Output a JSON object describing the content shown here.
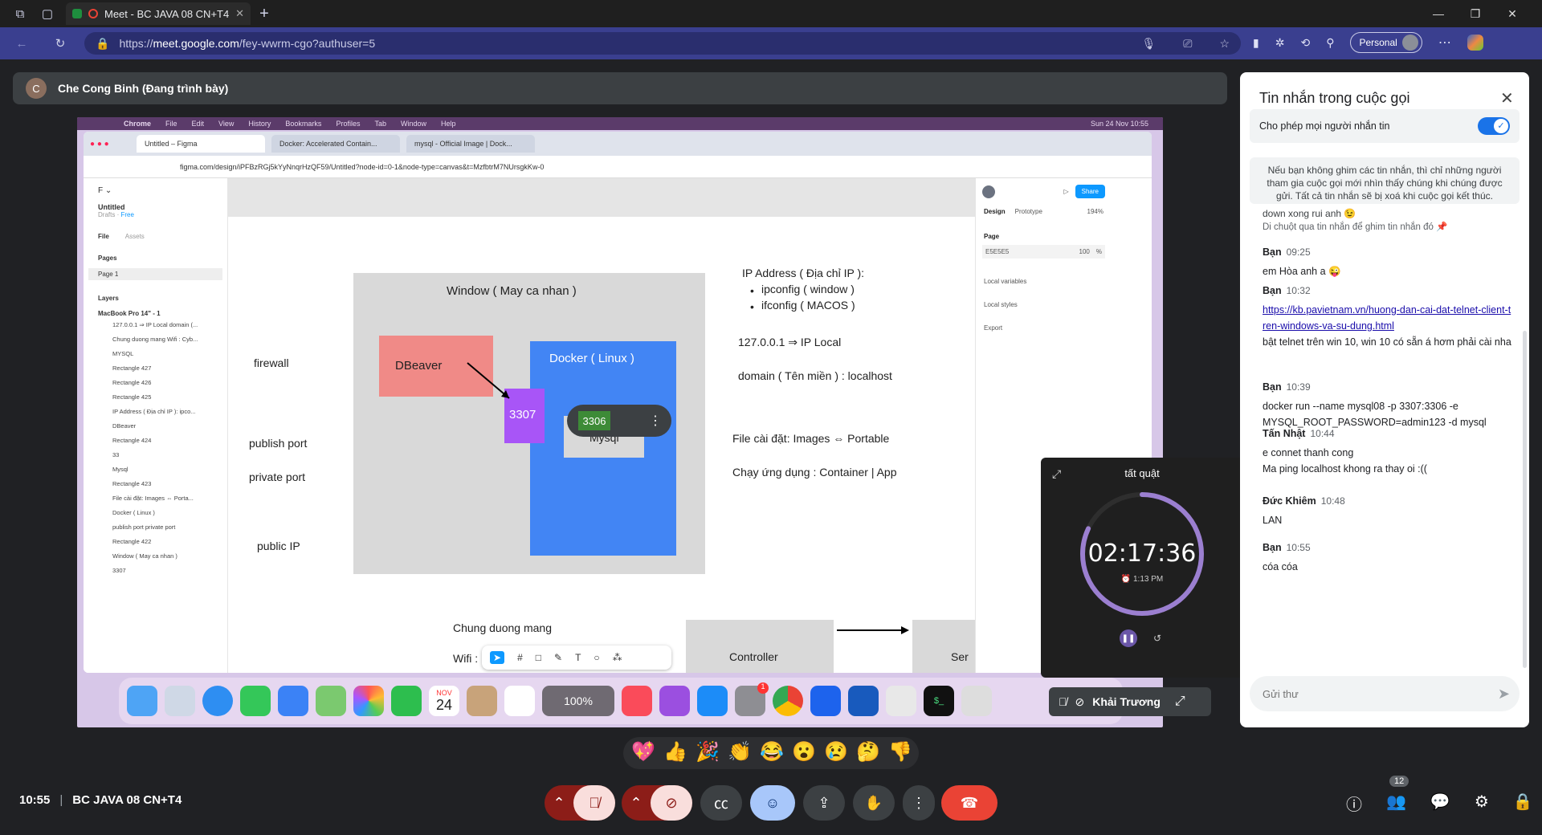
{
  "browser": {
    "tab_title": "Meet - BC JAVA 08 CN+T4",
    "url_prefix": "https://",
    "url_host": "meet.google.com",
    "url_path": "/fey-wwrm-cgo?authuser=5",
    "profile_label": "Personal"
  },
  "presenter": {
    "initial": "C",
    "label": "Che Cong Binh (Đang trình bày)"
  },
  "shared_screen": {
    "mac_menu": [
      "Chrome",
      "File",
      "Edit",
      "View",
      "History",
      "Bookmarks",
      "Profiles",
      "Tab",
      "Window",
      "Help"
    ],
    "mac_clock": "Sun 24 Nov  10:55",
    "tabs": [
      "Untitled – Figma",
      "Docker: Accelerated Contain...",
      "mysql - Official Image | Dock..."
    ],
    "url": "figma.com/design/iPFBzRGj5kYyNnqrHzQF59/Untitled?node-id=0-1&node-type=canvas&t=MzfbtrM7NUrsgkKw-0",
    "file_name": "Untitled",
    "drafts": "Drafts",
    "free": "Free",
    "file_tab": "File",
    "assets_tab": "Assets",
    "pages_label": "Pages",
    "page1": "Page 1",
    "layers_label": "Layers",
    "frame_name": "MacBook Pro 14\" - 1",
    "layers": [
      "127.0.0.1 ⇒ IP Local domain (...",
      "Chung duong mang Wifi : Cyb...",
      "MYSQL",
      "Rectangle 427",
      "Rectangle 426",
      "Rectangle 425",
      "IP Address ( Địa chỉ IP ): ipco...",
      "DBeaver",
      "Rectangle 424",
      "33",
      "Mysql",
      "Rectangle 423",
      "File cài đặt: Images ⇔ Porta...",
      "Docker ( Linux )",
      "publish port private port",
      "Rectangle 422",
      "Window ( May ca nhan )",
      "3307"
    ],
    "right_panel": {
      "design": "Design",
      "prototype": "Prototype",
      "zoom": "194%",
      "share": "Share",
      "page": "Page",
      "color": "E5E5E5",
      "opacity": "100",
      "pct": "%",
      "local_variables": "Local variables",
      "local_styles": "Local styles",
      "export": "Export"
    },
    "diagram": {
      "window_label": "Window ( May ca nhan )",
      "firewall": "firewall",
      "publish_port": "publish port",
      "private_port": "private port",
      "public_ip": "public IP",
      "dbeaver": "DBeaver",
      "docker": "Docker ( Linux )",
      "port_3307": "3307",
      "port_3306": "3306",
      "mysql": "Mysql",
      "ip_title": "IP Address ( Địa chỉ IP ):",
      "ip_bullets": [
        "ipconfig ( window )",
        "ifconfig ( MACOS )"
      ],
      "local": "127.0.0.1 ⇒ IP Local",
      "domain": "domain ( Tên miền ) : localhost",
      "install": "File cài đặt: Images ⇔ Portable",
      "run": "Chạy ứng dụng : Container | App",
      "network": "Chung duong mang",
      "wifi": "Wifi :",
      "controller": "Controller",
      "ser": "Ser"
    },
    "dock_zoom": "100%",
    "dock_date_month": "NOV",
    "dock_date_day": "24",
    "dock_badge": "1",
    "mini_tile_name": "Khải Trương"
  },
  "timer": {
    "title": "tất quật",
    "time": "02:17:36",
    "alarm": "1:13 PM",
    "progress_fraction": 0.82
  },
  "chat": {
    "title": "Tin nhắn trong cuộc gọi",
    "allow_label": "Cho phép mọi người nhắn tin",
    "notice": "Nếu bạn không ghim các tin nhắn, thì chỉ những người tham gia cuộc gọi mới nhìn thấy chúng khi chúng được gửi. Tất cả tin nhắn sẽ bị xoá khi cuộc gọi kết thúc.",
    "partial_top": "down xong rui anh 😉",
    "hint": "Di chuột qua tin nhắn để ghim tin nhắn đó 📌",
    "messages": [
      {
        "sender": "Bạn",
        "time": "09:25",
        "lines": [
          "em Hòa anh a 😜"
        ]
      },
      {
        "sender": "Bạn",
        "time": "10:32",
        "link": "https://kb.pavietnam.vn/huong-dan-cai-dat-telnet-client-tren-windows-va-su-dung.html",
        "lines": [
          "bật telnet trên win 10, win 10 có sẵn á hơm phải cài nha"
        ]
      },
      {
        "sender": "Bạn",
        "time": "10:39",
        "lines": [
          "docker run --name mysql08 -p 3307:3306 -e MYSQL_ROOT_PASSWORD=admin123 -d mysql"
        ]
      },
      {
        "sender": "Tấn Nhật",
        "time": "10:44",
        "lines": [
          "e connet thanh cong",
          "Ma ping localhost khong ra thay oi :(("
        ]
      },
      {
        "sender": "Đức Khiêm",
        "time": "10:48",
        "lines": [
          "LAN"
        ]
      },
      {
        "sender": "Bạn",
        "time": "10:55",
        "lines": [
          "cóa cóa"
        ]
      }
    ],
    "input_placeholder": "Gửi thư"
  },
  "reactions": [
    "💖",
    "👍",
    "🎉",
    "👏",
    "😂",
    "😮",
    "😢",
    "🤔",
    "👎"
  ],
  "bottom": {
    "time": "10:55",
    "meeting_name": "BC JAVA 08 CN+T4",
    "people_count": "12"
  },
  "colors": {
    "hangup": "#ea4335",
    "accent": "#1a73e8",
    "addr_bar": "#3a3f8f"
  }
}
